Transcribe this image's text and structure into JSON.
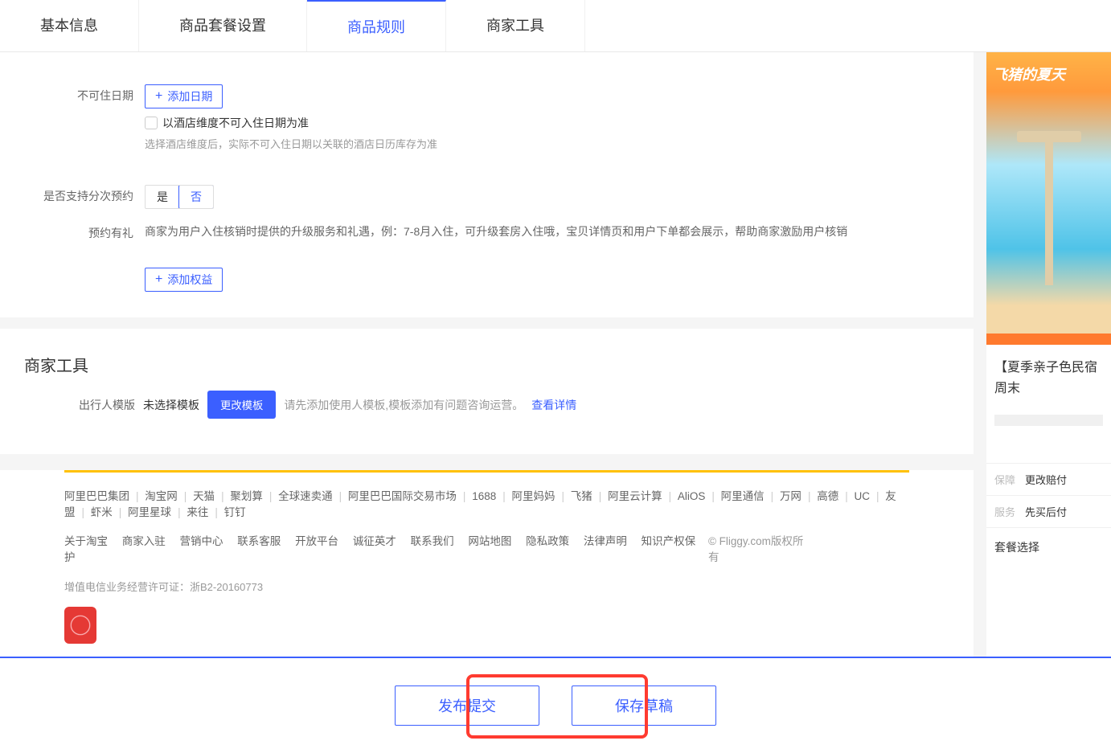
{
  "tabs": [
    "基本信息",
    "商品套餐设置",
    "商品规则",
    "商家工具"
  ],
  "activeTab": 2,
  "form": {
    "unavailableDateLabel": "不可住日期",
    "addDateBtn": "添加日期",
    "hotelDimCheckbox": "以酒店维度不可入住日期为准",
    "hotelDimHint": "选择酒店维度后，实际不可入住日期以关联的酒店日历库存为准",
    "splitBookingLabel": "是否支持分次预约",
    "yes": "是",
    "no": "否",
    "bookingGiftLabel": "预约有礼",
    "bookingGiftDesc": "商家为用户入住核销时提供的升级服务和礼遇，例：7-8月入住，可升级套房入住哦，宝贝详情页和用户下单都会展示，帮助商家激励用户核销",
    "addBenefitBtn": "添加权益"
  },
  "merchantTools": {
    "title": "商家工具",
    "travelerTemplateLabel": "出行人模版",
    "templateStatus": "未选择模板",
    "changeTemplateBtn": "更改模板",
    "templateHint": "请先添加使用人模板,模板添加有问题咨询运营。",
    "viewDetails": "查看详情"
  },
  "footer": {
    "row1": [
      "阿里巴巴集团",
      "淘宝网",
      "天猫",
      "聚划算",
      "全球速卖通",
      "阿里巴巴国际交易市场",
      "1688",
      "阿里妈妈",
      "飞猪",
      "阿里云计算",
      "AliOS",
      "阿里通信",
      "万网",
      "高德",
      "UC",
      "友盟",
      "虾米",
      "阿里星球",
      "来往",
      "钉钉"
    ],
    "row2": [
      "关于淘宝",
      "商家入驻",
      "营销中心",
      "联系客服",
      "开放平台",
      "诚征英才",
      "联系我们",
      "网站地图",
      "隐私政策",
      "法律声明",
      "知识产权保护"
    ],
    "copyright": "© Fliggy.com版权所有",
    "license": "增值电信业务经营许可证：浙B2-20160773"
  },
  "sidebar": {
    "promoText": "飞猪的夏天",
    "productTitle": "【夏季亲子色民宿周末",
    "guarantee": "保障",
    "guaranteeVal": "更改赔付",
    "service": "服务",
    "serviceVal": "先买后付",
    "packageSelect": "套餐选择"
  },
  "actions": {
    "publish": "发布提交",
    "saveDraft": "保存草稿"
  }
}
